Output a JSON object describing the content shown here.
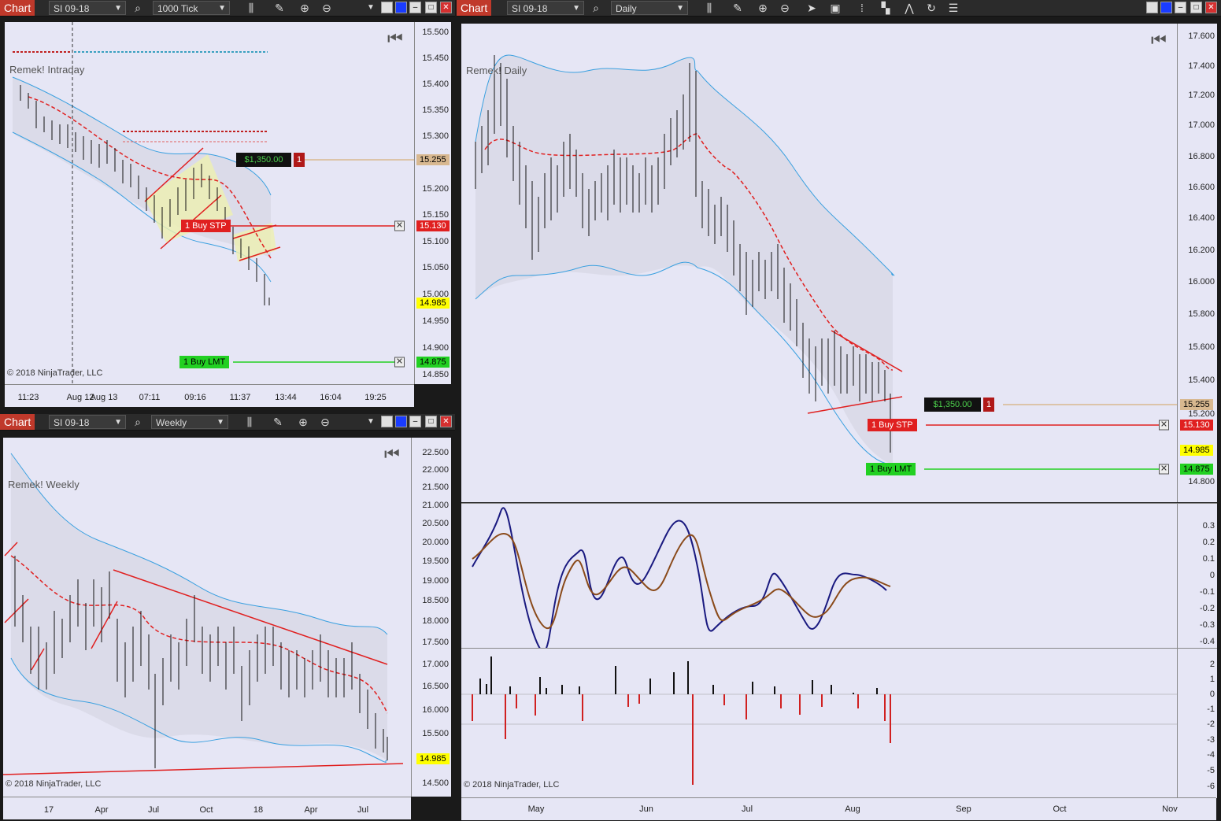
{
  "window1": {
    "title": "Chart",
    "instrument": "SI 09-18",
    "period": "1000 Tick",
    "label": "Remek! Intraday",
    "copyright": "© 2018 NinjaTrader, LLC",
    "y_ticks": [
      "15.500",
      "15.450",
      "15.400",
      "15.350",
      "15.300",
      "15.250",
      "15.200",
      "15.150",
      "15.100",
      "15.050",
      "15.000",
      "14.950",
      "14.900",
      "14.850"
    ],
    "x_ticks": [
      "11:23",
      "Aug 12",
      "Aug 13",
      "07:11",
      "09:16",
      "11:37",
      "13:44",
      "16:04",
      "19:25"
    ],
    "price_tags": {
      "target": "15.255",
      "stop": "15.130",
      "last": "14.985",
      "limit": "14.875"
    },
    "pnl": "$1,350.00",
    "pnl_qty": "1",
    "stop_order": "1  Buy STP",
    "limit_order": "1  Buy LMT"
  },
  "window2": {
    "title": "Chart",
    "instrument": "SI 09-18",
    "period": "Daily",
    "label": "Remek! Daily",
    "copyright": "© 2018 NinjaTrader, LLC",
    "y_ticks": [
      "17.600",
      "17.400",
      "17.200",
      "17.000",
      "16.800",
      "16.600",
      "16.400",
      "16.200",
      "16.000",
      "15.800",
      "15.600",
      "15.400",
      "15.200",
      "14.800"
    ],
    "osc_ticks": [
      "0.3",
      "0.2",
      "0.1",
      "0",
      "-0.1",
      "-0.2",
      "-0.3",
      "-0.4"
    ],
    "hist_ticks": [
      "2",
      "1",
      "0",
      "-1",
      "-2",
      "-3",
      "-4",
      "-5",
      "-6"
    ],
    "x_ticks": [
      "May",
      "Jun",
      "Jul",
      "Aug",
      "Sep",
      "Oct",
      "Nov"
    ],
    "price_tags": {
      "target": "15.255",
      "stop": "15.130",
      "last": "14.985",
      "limit": "14.875"
    },
    "pnl": "$1,350.00",
    "pnl_qty": "1",
    "stop_order": "1  Buy STP",
    "limit_order": "1  Buy LMT"
  },
  "window3": {
    "title": "Chart",
    "instrument": "SI 09-18",
    "period": "Weekly",
    "label": "Remek! Weekly",
    "copyright": "© 2018 NinjaTrader, LLC",
    "y_ticks": [
      "22.500",
      "22.000",
      "21.500",
      "21.000",
      "20.500",
      "20.000",
      "19.500",
      "19.000",
      "18.500",
      "18.000",
      "17.500",
      "17.000",
      "16.500",
      "16.000",
      "15.500",
      "14.500"
    ],
    "x_ticks": [
      "17",
      "Apr",
      "Jul",
      "Oct",
      "18",
      "Apr",
      "Jul"
    ],
    "price_tags": {
      "last": "14.985"
    }
  },
  "colors": {
    "title_bg": "#c0392b",
    "plot_bg": "#e6e6f5",
    "stop": "#e02020",
    "limit": "#22d022",
    "last": "#ffff00",
    "target": "#d8b890",
    "band": "#3aa0e0"
  }
}
